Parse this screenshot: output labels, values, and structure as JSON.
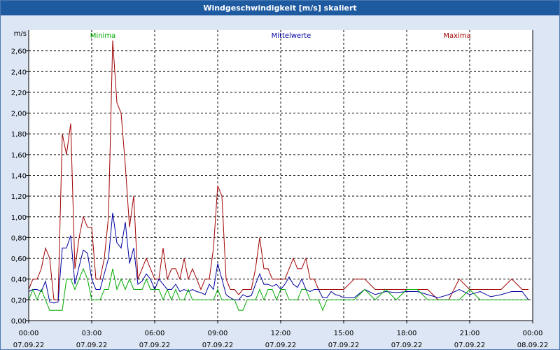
{
  "header": {
    "title": "Windgeschwindigkeit [m/s] skaliert"
  },
  "colors": {
    "min": "#00aa00",
    "mean": "#0000a0",
    "max": "#a00000",
    "grid": "#000000",
    "titlebar": "#1e5aa0"
  },
  "chart_data": {
    "type": "line",
    "title": "Windgeschwindigkeit [m/s] skaliert",
    "ylabel": "m/s",
    "xlabel": "",
    "ylim": [
      0,
      2.8
    ],
    "xlim": [
      0,
      24
    ],
    "grid": true,
    "legend_placement": "top",
    "y_ticks": [
      "0,00",
      "0,20",
      "0,40",
      "0,60",
      "0,80",
      "1,00",
      "1,20",
      "1,40",
      "1,60",
      "1,80",
      "2,00",
      "2,20",
      "2,40",
      "2,60"
    ],
    "x_ticks": [
      {
        "time": "00:00",
        "date": "07.09.22"
      },
      {
        "time": "03:00",
        "date": "07.09.22"
      },
      {
        "time": "06:00",
        "date": "07.09.22"
      },
      {
        "time": "09:00",
        "date": "07.09.22"
      },
      {
        "time": "12:00",
        "date": "07.09.22"
      },
      {
        "time": "15:00",
        "date": "07.09.22"
      },
      {
        "time": "18:00",
        "date": "07.09.22"
      },
      {
        "time": "21:00",
        "date": "07.09.22"
      },
      {
        "time": "00:00",
        "date": "08.09.22"
      }
    ],
    "series": [
      {
        "name": "Minima",
        "color": "#00aa00",
        "x": [
          0,
          0.2,
          0.4,
          0.6,
          0.8,
          1.0,
          1.2,
          1.4,
          1.6,
          1.8,
          2.0,
          2.2,
          2.4,
          2.6,
          2.8,
          3.0,
          3.2,
          3.4,
          3.6,
          3.8,
          4.0,
          4.2,
          4.4,
          4.6,
          4.8,
          5.0,
          5.2,
          5.4,
          5.6,
          5.8,
          6.0,
          6.2,
          6.4,
          6.6,
          6.8,
          7.0,
          7.2,
          7.4,
          7.6,
          7.8,
          8.0,
          8.2,
          8.4,
          8.6,
          8.8,
          9.0,
          9.2,
          9.4,
          9.6,
          9.8,
          10.0,
          10.2,
          10.4,
          10.6,
          10.8,
          11.0,
          11.2,
          11.4,
          11.6,
          11.8,
          12.0,
          12.2,
          12.4,
          12.6,
          12.8,
          13.0,
          13.2,
          13.4,
          13.6,
          13.8,
          14.0,
          14.2,
          14.4,
          14.6,
          14.8,
          15.0,
          15.5,
          16.0,
          16.5,
          17.0,
          17.5,
          18.0,
          18.5,
          19.0,
          19.5,
          20.0,
          20.5,
          21.0,
          21.5,
          22.0,
          22.5,
          23.0,
          23.5,
          23.8
        ],
        "y": [
          0.2,
          0.3,
          0.2,
          0.3,
          0.2,
          0.1,
          0.1,
          0.1,
          0.1,
          0.4,
          0.4,
          0.3,
          0.4,
          0.5,
          0.4,
          0.2,
          0.2,
          0.2,
          0.3,
          0.3,
          0.5,
          0.3,
          0.4,
          0.3,
          0.4,
          0.3,
          0.3,
          0.3,
          0.4,
          0.3,
          0.3,
          0.3,
          0.2,
          0.3,
          0.2,
          0.3,
          0.2,
          0.2,
          0.3,
          0.2,
          0.2,
          0.2,
          0.2,
          0.2,
          0.2,
          0.3,
          0.2,
          0.2,
          0.2,
          0.2,
          0.1,
          0.1,
          0.2,
          0.2,
          0.2,
          0.3,
          0.2,
          0.3,
          0.3,
          0.2,
          0.3,
          0.3,
          0.2,
          0.2,
          0.2,
          0.3,
          0.3,
          0.2,
          0.2,
          0.2,
          0.1,
          0.2,
          0.2,
          0.2,
          0.2,
          0.2,
          0.2,
          0.3,
          0.2,
          0.3,
          0.2,
          0.3,
          0.3,
          0.2,
          0.2,
          0.2,
          0.2,
          0.3,
          0.2,
          0.2,
          0.2,
          0.2,
          0.2,
          0.2
        ]
      },
      {
        "name": "Mittelwerte",
        "color": "#0000a0",
        "x": [
          0,
          0.2,
          0.4,
          0.6,
          0.8,
          1.0,
          1.2,
          1.4,
          1.6,
          1.8,
          2.0,
          2.2,
          2.4,
          2.6,
          2.8,
          3.0,
          3.2,
          3.4,
          3.6,
          3.8,
          4.0,
          4.2,
          4.4,
          4.6,
          4.8,
          5.0,
          5.2,
          5.4,
          5.6,
          5.8,
          6.0,
          6.2,
          6.4,
          6.6,
          6.8,
          7.0,
          7.2,
          7.4,
          7.6,
          7.8,
          8.0,
          8.2,
          8.4,
          8.6,
          8.8,
          9.0,
          9.2,
          9.4,
          9.6,
          9.8,
          10.0,
          10.2,
          10.4,
          10.6,
          10.8,
          11.0,
          11.2,
          11.4,
          11.6,
          11.8,
          12.0,
          12.2,
          12.4,
          12.6,
          12.8,
          13.0,
          13.2,
          13.4,
          13.6,
          13.8,
          14.0,
          14.2,
          14.4,
          14.6,
          14.8,
          15.0,
          15.5,
          16.0,
          16.5,
          17.0,
          17.5,
          18.0,
          18.5,
          19.0,
          19.5,
          20.0,
          20.5,
          21.0,
          21.5,
          22.0,
          22.5,
          23.0,
          23.5,
          23.8
        ],
        "y": [
          0.28,
          0.3,
          0.3,
          0.28,
          0.38,
          0.18,
          0.17,
          0.18,
          0.7,
          0.7,
          0.82,
          0.35,
          0.52,
          0.68,
          0.65,
          0.4,
          0.3,
          0.3,
          0.45,
          0.6,
          1.04,
          0.75,
          0.7,
          0.95,
          0.55,
          0.7,
          0.35,
          0.38,
          0.45,
          0.4,
          0.3,
          0.4,
          0.35,
          0.3,
          0.3,
          0.35,
          0.28,
          0.3,
          0.28,
          0.3,
          0.28,
          0.27,
          0.25,
          0.35,
          0.3,
          0.55,
          0.4,
          0.25,
          0.22,
          0.2,
          0.2,
          0.25,
          0.23,
          0.24,
          0.35,
          0.45,
          0.35,
          0.35,
          0.33,
          0.35,
          0.3,
          0.35,
          0.42,
          0.35,
          0.32,
          0.4,
          0.3,
          0.28,
          0.3,
          0.3,
          0.22,
          0.22,
          0.28,
          0.25,
          0.24,
          0.22,
          0.22,
          0.3,
          0.25,
          0.28,
          0.27,
          0.28,
          0.28,
          0.25,
          0.22,
          0.25,
          0.3,
          0.25,
          0.28,
          0.23,
          0.25,
          0.28,
          0.28,
          0.2
        ]
      },
      {
        "name": "Maxima",
        "color": "#a00000",
        "x": [
          0,
          0.2,
          0.4,
          0.6,
          0.8,
          1.0,
          1.2,
          1.4,
          1.6,
          1.8,
          2.0,
          2.2,
          2.4,
          2.6,
          2.8,
          3.0,
          3.2,
          3.4,
          3.6,
          3.8,
          4.0,
          4.2,
          4.4,
          4.6,
          4.8,
          5.0,
          5.2,
          5.4,
          5.6,
          5.8,
          6.0,
          6.2,
          6.4,
          6.6,
          6.8,
          7.0,
          7.2,
          7.4,
          7.6,
          7.8,
          8.0,
          8.2,
          8.4,
          8.6,
          8.8,
          9.0,
          9.2,
          9.4,
          9.6,
          9.8,
          10.0,
          10.2,
          10.4,
          10.6,
          10.8,
          11.0,
          11.2,
          11.4,
          11.6,
          11.8,
          12.0,
          12.2,
          12.4,
          12.6,
          12.8,
          13.0,
          13.2,
          13.4,
          13.6,
          13.8,
          14.0,
          14.2,
          14.4,
          14.6,
          14.8,
          15.0,
          15.5,
          16.0,
          16.5,
          17.0,
          17.5,
          18.0,
          18.5,
          19.0,
          19.5,
          20.0,
          20.5,
          21.0,
          21.5,
          22.0,
          22.5,
          23.0,
          23.5,
          23.8
        ],
        "y": [
          0.3,
          0.4,
          0.4,
          0.5,
          0.7,
          0.6,
          0.2,
          0.2,
          1.8,
          1.6,
          1.9,
          0.5,
          0.8,
          1.0,
          0.9,
          0.9,
          0.4,
          0.4,
          0.6,
          1.0,
          2.7,
          2.1,
          2.0,
          1.5,
          0.9,
          1.2,
          0.4,
          0.5,
          0.6,
          0.5,
          0.4,
          0.4,
          0.7,
          0.4,
          0.5,
          0.5,
          0.4,
          0.6,
          0.4,
          0.5,
          0.4,
          0.3,
          0.4,
          0.4,
          0.7,
          1.3,
          1.2,
          0.4,
          0.3,
          0.3,
          0.25,
          0.3,
          0.3,
          0.3,
          0.5,
          0.8,
          0.5,
          0.5,
          0.4,
          0.4,
          0.4,
          0.4,
          0.5,
          0.6,
          0.5,
          0.5,
          0.6,
          0.4,
          0.4,
          0.3,
          0.3,
          0.3,
          0.3,
          0.3,
          0.3,
          0.3,
          0.4,
          0.4,
          0.3,
          0.3,
          0.3,
          0.3,
          0.3,
          0.3,
          0.2,
          0.2,
          0.4,
          0.3,
          0.3,
          0.3,
          0.3,
          0.4,
          0.3,
          0.3
        ]
      }
    ]
  }
}
